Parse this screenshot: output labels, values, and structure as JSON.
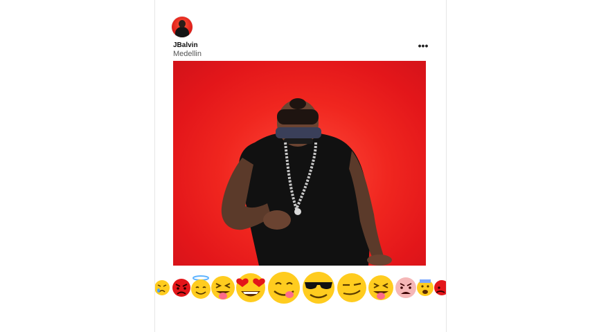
{
  "post": {
    "username": "JBalvin",
    "location": "Medellin",
    "more_label": "•••"
  },
  "photo": {
    "background_color": "#e81d1d",
    "subject": "man in black t-shirt dancing"
  },
  "reactions": {
    "emojis": [
      "crying-face-icon",
      "angry-face-icon",
      "halo-smiling-face-icon",
      "tongue-out-squinting-face-icon",
      "heart-eyes-face-icon",
      "yum-face-icon",
      "sunglasses-face-icon",
      "smirking-face-icon",
      "tongue-out-squinting-face-icon",
      "disgusted-face-icon",
      "scared-face-icon",
      "angry-face-icon"
    ]
  },
  "colors": {
    "accent_red": "#e3161a",
    "emoji_yellow": "#ffcc1f"
  }
}
